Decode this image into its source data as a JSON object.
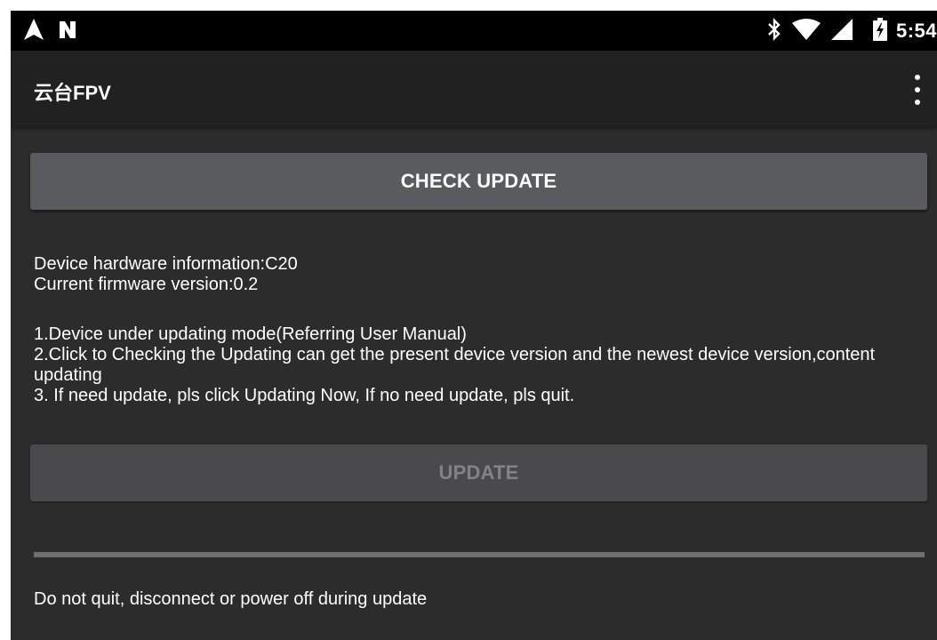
{
  "status_bar": {
    "left_icons": [
      "navigation-arrow-icon",
      "nfc-n-icon"
    ],
    "right_icons": [
      "bluetooth-icon",
      "wifi-icon",
      "cell-signal-icon",
      "battery-charging-icon"
    ],
    "time": "5:54"
  },
  "app_bar": {
    "title": "云台FPV",
    "menu_icon": "overflow-menu-icon"
  },
  "main": {
    "check_update_label": "CHECK UPDATE",
    "device_info": {
      "hardware": "Device hardware information:C20",
      "firmware": "Current firmware version:0.2"
    },
    "instructions": [
      "1.Device under updating mode(Referring User Manual)",
      "2.Click to Checking the Updating can get the present device version and the newest device version,content updating",
      "3. If need update, pls click Updating Now, If no need update, pls quit."
    ],
    "update_label": "UPDATE",
    "update_enabled": false,
    "progress_percent": 0,
    "warning": "Do not quit, disconnect or power off during update"
  },
  "colors": {
    "background": "#2c2c2c",
    "app_bar": "#212121",
    "status_bar": "#000000",
    "button_active": "#5a5b5f",
    "button_disabled": "#4a4a4c",
    "button_disabled_text": "#838385",
    "progress_track": "#6f6f6f"
  }
}
